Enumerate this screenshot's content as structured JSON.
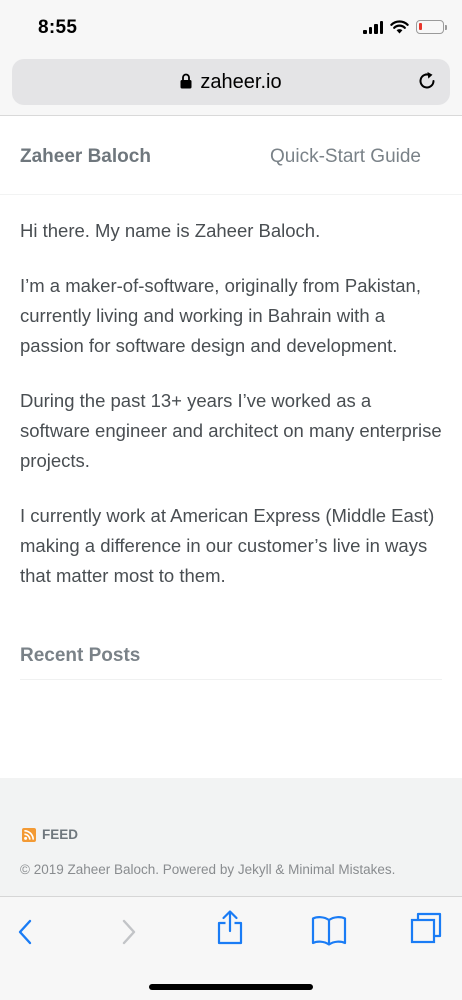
{
  "status": {
    "time": "8:55"
  },
  "browser": {
    "url": "zaheer.io"
  },
  "masthead": {
    "site_title": "Zaheer Baloch",
    "nav_link": "Quick-Start Guide"
  },
  "main": {
    "paragraphs": [
      "Hi there. My name is Zaheer Baloch.",
      "I’m a maker-of-software, originally from Pakistan, currently living and working in Bahrain with a passion for software design and development.",
      "During the past 13+ years I’ve worked as a software engineer and architect on many enterprise projects.",
      "I currently work at American Express (Middle East) making a difference in our customer’s live in ways that matter most to them."
    ],
    "recent_posts_title": "Recent Posts"
  },
  "footer": {
    "feed_label": "FEED",
    "copyright": "© 2019 Zaheer Baloch. Powered by Jekyll & Minimal Mistakes."
  },
  "icons": {
    "lock": "lock-icon",
    "reload": "reload-icon",
    "rss": "rss-icon",
    "back": "back-icon",
    "forward": "forward-icon",
    "share": "share-icon",
    "bookmarks": "bookmarks-icon",
    "tabs": "tabs-icon"
  },
  "colors": {
    "accent": "#1a7cf5",
    "rss": "#f39a34",
    "battery_low": "#e8352b"
  }
}
